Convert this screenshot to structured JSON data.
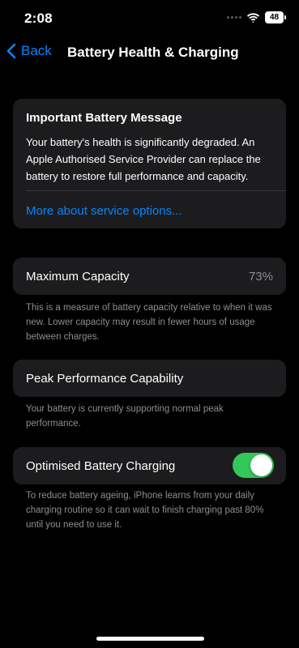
{
  "status_bar": {
    "time": "2:08",
    "battery_level": "48"
  },
  "nav": {
    "back_label": "Back",
    "title": "Battery Health & Charging"
  },
  "message": {
    "title": "Important Battery Message",
    "body": "Your battery's health is significantly degraded. An Apple Authorised Service Provider can replace the battery to restore full performance and capacity.",
    "link": "More about service options..."
  },
  "capacity": {
    "label": "Maximum Capacity",
    "value": "73%",
    "note": "This is a measure of battery capacity relative to when it was new. Lower capacity may result in fewer hours of usage between charges."
  },
  "peak": {
    "label": "Peak Performance Capability",
    "note": "Your battery is currently supporting normal peak performance."
  },
  "charging": {
    "label": "Optimised Battery Charging",
    "enabled": true,
    "note": "To reduce battery ageing, iPhone learns from your daily charging routine so it can wait to finish charging past 80% until you need to use it."
  },
  "colors": {
    "background": "#000000",
    "card": "#1c1c1e",
    "accent_blue": "#0a84ff",
    "toggle_on": "#34c759",
    "secondary_text": "#8e8e93"
  },
  "icons": [
    "dots-icon",
    "wifi-icon",
    "battery-icon",
    "chevron-left-icon"
  ]
}
